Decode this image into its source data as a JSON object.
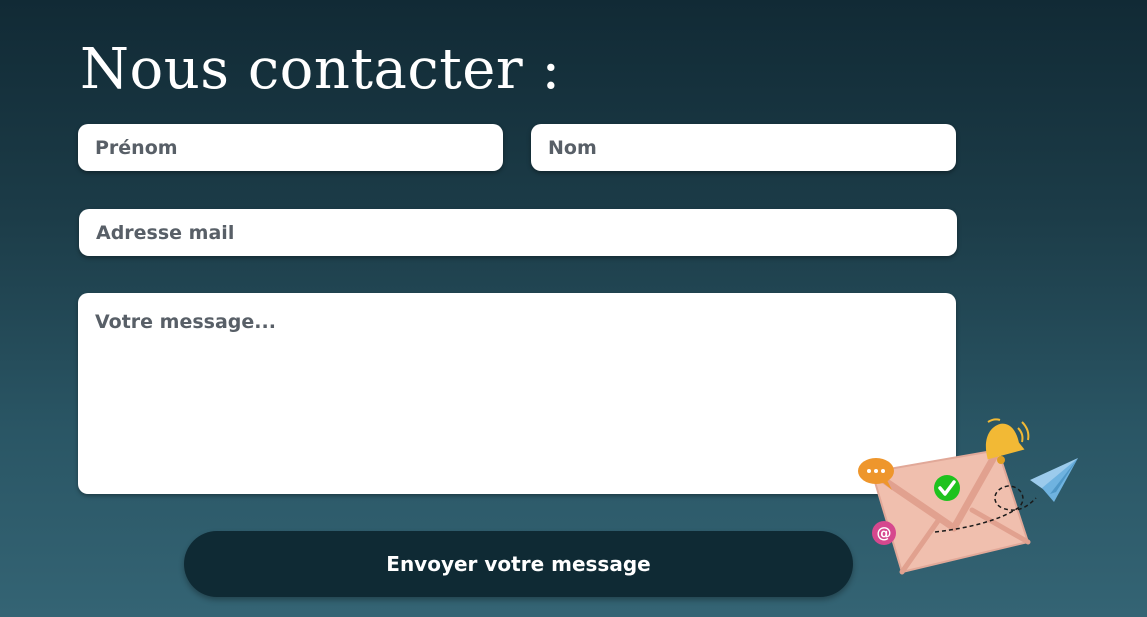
{
  "page": {
    "title": "Nous contacter :"
  },
  "form": {
    "first_name_placeholder": "Prénom",
    "last_name_placeholder": "Nom",
    "email_placeholder": "Adresse mail",
    "message_placeholder": "Votre message...",
    "submit_label": "Envoyer votre message"
  },
  "illustration": {
    "icons": [
      "envelope-icon",
      "checkmark-icon",
      "bell-icon",
      "paper-plane-icon",
      "chat-bubble-icon",
      "at-sign-icon"
    ]
  },
  "colors": {
    "background_top": "#112a35",
    "background_bottom": "#346474",
    "button": "#0f2a34",
    "envelope": "#f0bfae",
    "bell": "#f2b935",
    "check": "#1ec21e",
    "chat_bubble": "#ee962c",
    "at_sign": "#d6488e",
    "plane": "#6fb3e0"
  }
}
